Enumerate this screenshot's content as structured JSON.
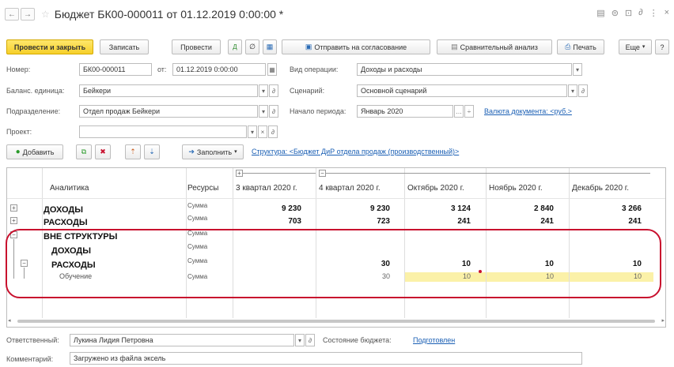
{
  "window": {
    "title": "Бюджет БК00-000011 от 01.12.2019 0:00:00 *",
    "back_icon": "arrow-left",
    "forward_icon": "arrow-right",
    "fav_icon": "star",
    "right_icons": [
      "▤",
      "⊜",
      "⊡",
      "∂",
      "⋮",
      "×"
    ]
  },
  "toolbar": {
    "post_close": "Провести и закрыть",
    "write": "Записать",
    "post": "Провести",
    "send_approval": "Отправить на согласование",
    "compare": "Сравнительный анализ",
    "print": "Печать",
    "more": "Еще",
    "help": "?"
  },
  "form": {
    "number_label": "Номер:",
    "number_value": "БК00-000011",
    "from_label": "от:",
    "date_value": "01.12.2019 0:00:00",
    "op_type_label": "Вид операции:",
    "op_type_value": "Доходы и расходы",
    "unit_label": "Баланс. единица:",
    "unit_value": "Бейкери",
    "scenario_label": "Сценарий:",
    "scenario_value": "Основной сценарий",
    "dept_label": "Подразделение:",
    "dept_value": "Отдел продаж Бейкери",
    "period_label": "Начало периода:",
    "period_value": "Январь 2020",
    "currency_link": "Валюта документа: <руб.>",
    "project_label": "Проект:",
    "project_value": ""
  },
  "table_toolbar": {
    "add": "Добавить",
    "fill": "Заполнить",
    "structure_link": "Структура: <Бюджет ДиР отдела продаж (производственный)>"
  },
  "table": {
    "headers": {
      "analytics": "Аналитика",
      "resources": "Ресурсы",
      "q3": "3 квартал 2020 г.",
      "q4": "4 квартал 2020 г.",
      "oct": "Октябрь 2020 г.",
      "nov": "Ноябрь 2020 г.",
      "dec": "Декабрь 2020 г."
    },
    "rows": [
      {
        "name": "ДОХОДЫ",
        "res": "Сумма",
        "q3": "9 230",
        "q4": "9 230",
        "oct": "3 124",
        "nov": "2 840",
        "dec": "3 266"
      },
      {
        "name": "РАСХОДЫ",
        "res": "Сумма",
        "q3": "703",
        "q4": "723",
        "oct": "241",
        "nov": "241",
        "dec": "241"
      },
      {
        "name": "ВНЕ СТРУКТУРЫ",
        "res": "Сумма",
        "q3": "",
        "q4": "",
        "oct": "",
        "nov": "",
        "dec": ""
      },
      {
        "name": "ДОХОДЫ",
        "res": "Сумма",
        "q3": "",
        "q4": "",
        "oct": "",
        "nov": "",
        "dec": ""
      },
      {
        "name": "РАСХОДЫ",
        "res": "Сумма",
        "q3": "",
        "q4": "30",
        "oct": "10",
        "nov": "10",
        "dec": "10"
      },
      {
        "name": "Обучение",
        "res": "Сумма",
        "q3": "",
        "q4": "30",
        "oct": "10",
        "nov": "10",
        "dec": "10"
      }
    ]
  },
  "footer": {
    "responsible_label": "Ответственный:",
    "responsible_value": "Лукина Лидия Петровна",
    "state_label": "Состояние бюджета:",
    "state_value": "Подготовлен",
    "comment_label": "Комментарий:",
    "comment_value": "Загружено из файла эксель"
  }
}
